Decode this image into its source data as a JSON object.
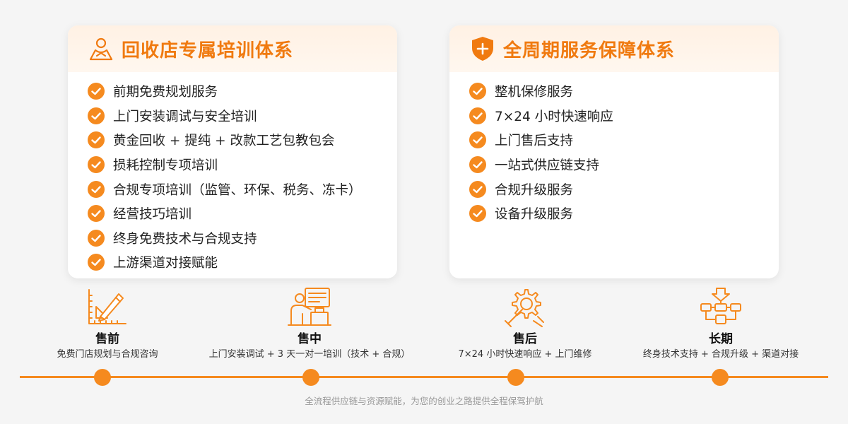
{
  "left_card": {
    "title": "回收店专属培训体系",
    "icon": "person-icon",
    "items": [
      "前期免费规划服务",
      "上门安装调试与安全培训",
      "黄金回收 + 提纯 + 改款工艺包教包会",
      "损耗控制专项培训",
      "合规专项培训（监管、环保、税务、冻卡）",
      "经营技巧培训",
      "终身免费技术与合规支持",
      "上游渠道对接赋能"
    ]
  },
  "right_card": {
    "title": "全周期服务保障体系",
    "icon": "shield-plus-icon",
    "items": [
      "整机保修服务",
      "7×24 小时快速响应",
      "上门售后支持",
      "一站式供应链支持",
      "合规升级服务",
      "设备升级服务"
    ]
  },
  "timeline": {
    "stages": [
      {
        "title": "售前",
        "desc": "免费门店规划与合规咨询",
        "icon": "drafting-icon"
      },
      {
        "title": "售中",
        "desc": "上门安装调试 + 3 天一对一培训（技术 + 合规）",
        "icon": "training-icon"
      },
      {
        "title": "售后",
        "desc": "7×24 小时快速响应 + 上门维修",
        "icon": "wrench-gear-icon"
      },
      {
        "title": "长期",
        "desc": "终身技术支持 + 合规升级 + 渠道对接",
        "icon": "flow-icon"
      }
    ]
  },
  "footer": {
    "text": "全流程供应链与资源赋能，为您的创业之路提供全程保驾护航"
  },
  "colors": {
    "accent": "#f58a1f",
    "title": "#f07a10",
    "header_bg": "#fff1e4"
  }
}
